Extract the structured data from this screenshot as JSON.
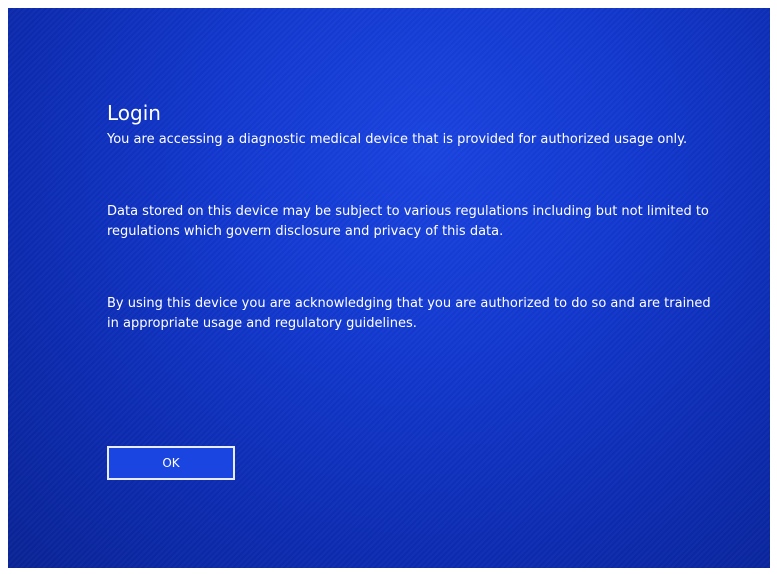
{
  "dialog": {
    "title": "Login",
    "paragraphs": [
      "You are accessing a diagnostic medical device that is provided for authorized usage only.",
      "Data stored on this device may be subject to various regulations including but not limited to regulations which govern disclosure and privacy of this data.",
      "By using this device you are acknowledging that you are authorized to do so and are trained in appropriate usage and regulatory guidelines."
    ],
    "ok_label": "OK"
  },
  "colors": {
    "background": "#1238cf",
    "text": "#ffffff"
  }
}
